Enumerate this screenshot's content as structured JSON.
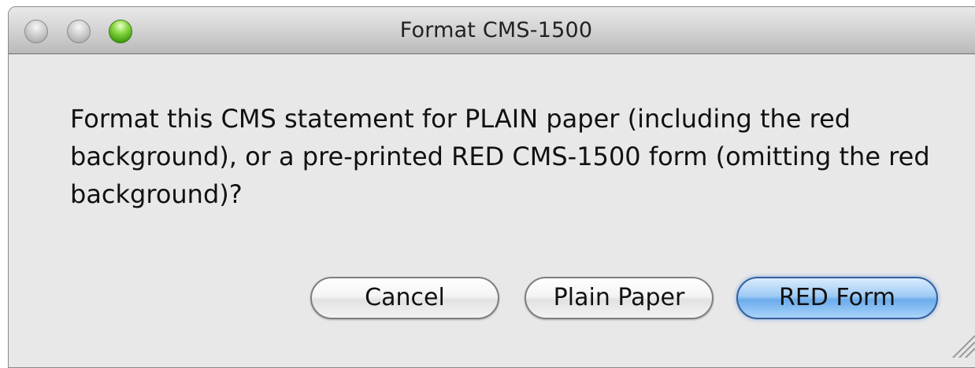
{
  "window": {
    "title": "Format CMS-1500"
  },
  "dialog": {
    "message": "Format this CMS statement for PLAIN paper (including the red background), or a pre-printed RED CMS-1500 form (omitting the red background)?"
  },
  "buttons": {
    "cancel": "Cancel",
    "plain_paper": "Plain Paper",
    "red_form": "RED Form"
  },
  "icons": {
    "close": "close-icon",
    "minimize": "minimize-icon",
    "zoom": "zoom-icon",
    "resize": "resize-grip-icon"
  },
  "colors": {
    "default_button": "#6cacec",
    "zoom_button": "#3e9c0d",
    "window_bg": "#e8e8e8"
  }
}
